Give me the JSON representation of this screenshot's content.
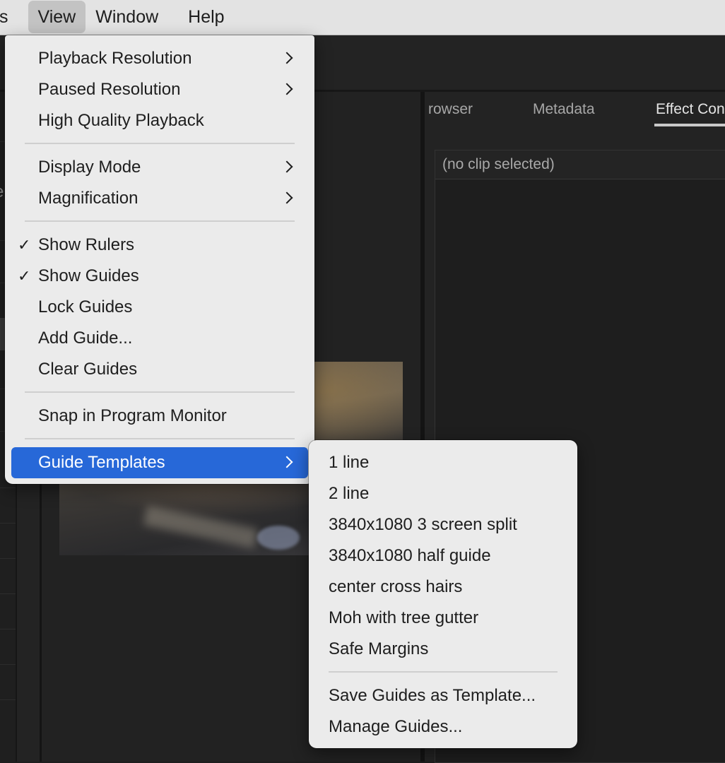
{
  "menubar": {
    "items": [
      {
        "label": "s",
        "active": false
      },
      {
        "label": "View",
        "active": true
      },
      {
        "label": "Window",
        "active": false
      },
      {
        "label": "Help",
        "active": false
      }
    ]
  },
  "background_app": {
    "tabs": [
      {
        "label": "rowser",
        "active": false
      },
      {
        "label": "Metadata",
        "active": false
      },
      {
        "label": "Effect Con",
        "active": true
      }
    ],
    "effect_controls_status": "(no clip selected)",
    "left_partial_char": "e"
  },
  "view_menu": {
    "items": [
      {
        "label": "Playback Resolution",
        "submenu": true,
        "checked": false
      },
      {
        "label": "Paused Resolution",
        "submenu": true,
        "checked": false
      },
      {
        "label": "High Quality Playback",
        "submenu": false,
        "checked": false
      },
      {
        "label": "Display Mode",
        "submenu": true,
        "checked": false
      },
      {
        "label": "Magnification",
        "submenu": true,
        "checked": false
      },
      {
        "label": "Show Rulers",
        "submenu": false,
        "checked": true
      },
      {
        "label": "Show Guides",
        "submenu": false,
        "checked": true
      },
      {
        "label": "Lock Guides",
        "submenu": false,
        "checked": false
      },
      {
        "label": "Add Guide...",
        "submenu": false,
        "checked": false
      },
      {
        "label": "Clear Guides",
        "submenu": false,
        "checked": false
      },
      {
        "label": "Snap in Program Monitor",
        "submenu": false,
        "checked": false
      },
      {
        "label": "Guide Templates",
        "submenu": true,
        "checked": false,
        "highlighted": true
      }
    ],
    "check_glyph": "✓"
  },
  "guide_templates_submenu": {
    "items": [
      {
        "label": "1 line"
      },
      {
        "label": "2 line"
      },
      {
        "label": "3840x1080 3 screen split"
      },
      {
        "label": "3840x1080 half guide"
      },
      {
        "label": "center cross hairs"
      },
      {
        "label": "Moh with tree gutter"
      },
      {
        "label": "Safe Margins"
      },
      {
        "label": "Save Guides as Template..."
      },
      {
        "label": "Manage Guides..."
      }
    ]
  },
  "colors": {
    "highlight": "#2768d8",
    "menu_bg": "#ebebeb",
    "menubar_bg": "#e3e3e3",
    "app_bg": "#232323"
  }
}
